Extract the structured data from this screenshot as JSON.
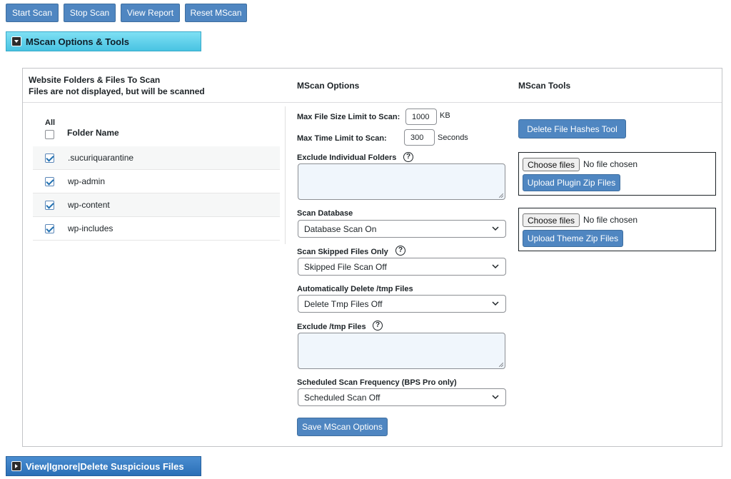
{
  "toolbar": {
    "start_scan": "Start Scan",
    "stop_scan": "Stop Scan",
    "view_report": "View Report",
    "reset_mscan": "Reset MScan"
  },
  "accordions": {
    "options_tools": "MScan Options & Tools",
    "view_ignore_delete": "View|Ignore|Delete Suspicious Files"
  },
  "folders": {
    "heading_line1": "Website Folders & Files To Scan",
    "heading_line2": "Files are not displayed, but will be scanned",
    "all_label": "All",
    "all_checked": false,
    "column_header": "Folder Name",
    "rows": [
      {
        "name": ".sucuriquarantine",
        "checked": true
      },
      {
        "name": "wp-admin",
        "checked": true
      },
      {
        "name": "wp-content",
        "checked": true
      },
      {
        "name": "wp-includes",
        "checked": true
      }
    ]
  },
  "options": {
    "heading": "MScan Options",
    "max_file_size_label": "Max File Size Limit to Scan:",
    "max_file_size_value": "1000",
    "max_file_size_unit": "KB",
    "max_time_label": "Max Time Limit to Scan:",
    "max_time_value": "300",
    "max_time_unit": "Seconds",
    "exclude_folders_label": "Exclude Individual Folders",
    "exclude_folders_value": "",
    "scan_database_label": "Scan Database",
    "scan_database_value": "Database Scan On",
    "scan_skipped_label": "Scan Skipped Files Only",
    "scan_skipped_value": "Skipped File Scan Off",
    "auto_delete_tmp_label": "Automatically Delete /tmp Files",
    "auto_delete_tmp_value": "Delete Tmp Files Off",
    "exclude_tmp_label": "Exclude /tmp Files",
    "exclude_tmp_value": "",
    "schedule_label": "Scheduled Scan Frequency (BPS Pro only)",
    "schedule_value": "Scheduled Scan Off",
    "save_button": "Save MScan Options",
    "help_glyph": "?"
  },
  "tools": {
    "heading": "MScan Tools",
    "delete_hashes_button": "Delete File Hashes Tool",
    "choose_files": "Choose files",
    "no_file": "No file chosen",
    "upload_plugin": "Upload Plugin Zip Files",
    "upload_theme": "Upload Theme Zip Files"
  },
  "colors": {
    "button_blue": "#4f86c1",
    "accordion_cyan": "#48c3e2",
    "accordion_blue": "#2a6fb7"
  }
}
